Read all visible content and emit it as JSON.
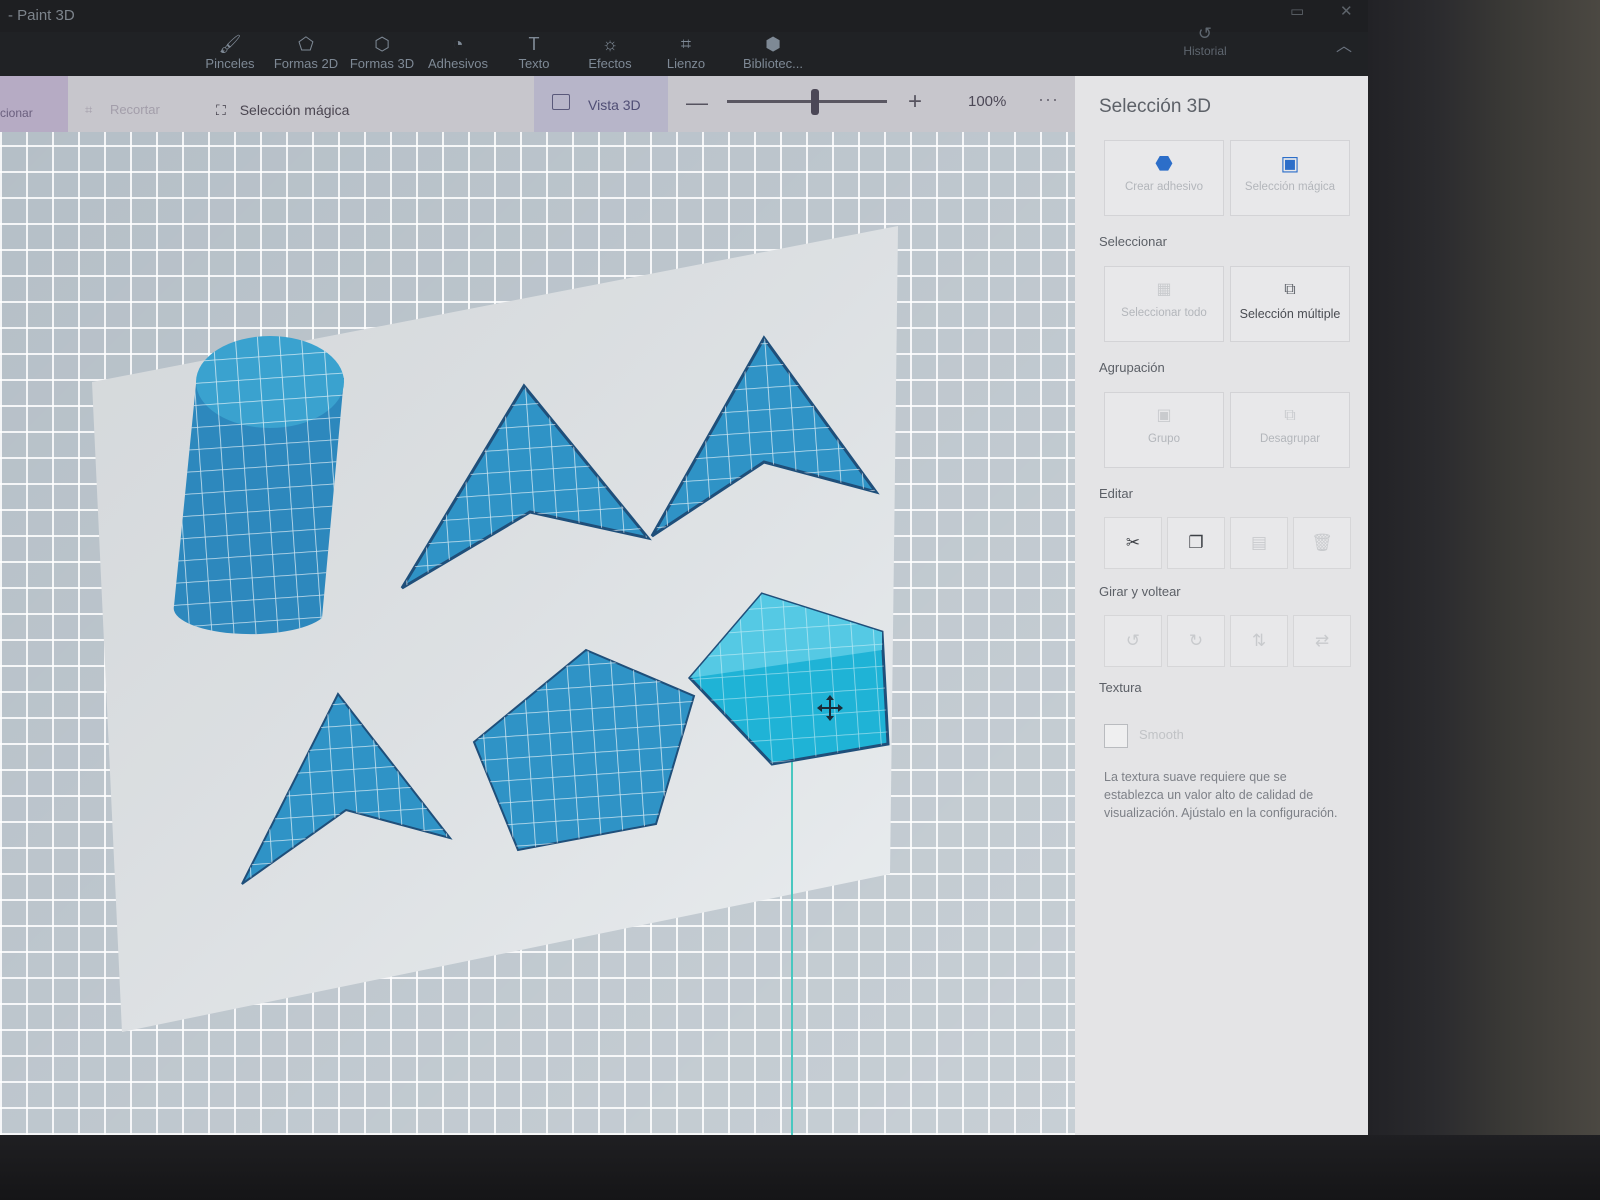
{
  "window": {
    "title": "- Paint 3D"
  },
  "ribbon": {
    "tools": [
      {
        "label": "Pinceles",
        "icon": "brush-icon",
        "glyph": "🖌"
      },
      {
        "label": "Formas 2D",
        "icon": "shapes-2d-icon",
        "glyph": "⬠"
      },
      {
        "label": "Formas 3D",
        "icon": "cube-icon",
        "glyph": "⬡"
      },
      {
        "label": "Adhesivos",
        "icon": "sticker-icon",
        "glyph": "◔"
      },
      {
        "label": "Texto",
        "icon": "text-icon",
        "glyph": "T"
      },
      {
        "label": "Efectos",
        "icon": "effects-sun-icon",
        "glyph": "☼"
      },
      {
        "label": "Lienzo",
        "icon": "canvas-crop-icon",
        "glyph": "⌗"
      },
      {
        "label": "Bibliotec...",
        "icon": "library-icon",
        "glyph": "⬢"
      }
    ],
    "historial": {
      "label": "Historial",
      "icon": "history-icon",
      "glyph": "↺"
    },
    "collapse_glyph": "︿"
  },
  "subbar": {
    "select_label": "cionar",
    "crop_label": "Recortar",
    "magic_label": "Selección mágica",
    "view3d_label": "Vista 3D",
    "zoom_minus": "—",
    "zoom_plus": "+",
    "zoom_value": "100%",
    "zoom_level": 0.55,
    "more": "···"
  },
  "panel": {
    "title": "Selección 3D",
    "sticker_btn": "Crear adhesivo",
    "magic_btn": "Selección mágica",
    "section_select": "Seleccionar",
    "select_all_btn": "Seleccionar todo",
    "multi_select_btn": "Selección múltiple",
    "section_group": "Agrupación",
    "group_btn": "Grupo",
    "ungroup_btn": "Desagrupar",
    "section_edit": "Editar",
    "section_rotate": "Girar y voltear",
    "section_texture": "Textura",
    "smooth_label": "Smooth",
    "texture_note": "La textura suave requiere que se establezca un valor alto de calidad de visualización. Ajústalo en la configuración."
  },
  "colors": {
    "shape_fill": "#2f93c6",
    "shape_selected": "#1fb3d6",
    "shape_edge": "#1f4f7a",
    "panel_bg": "#e4e4e6"
  }
}
